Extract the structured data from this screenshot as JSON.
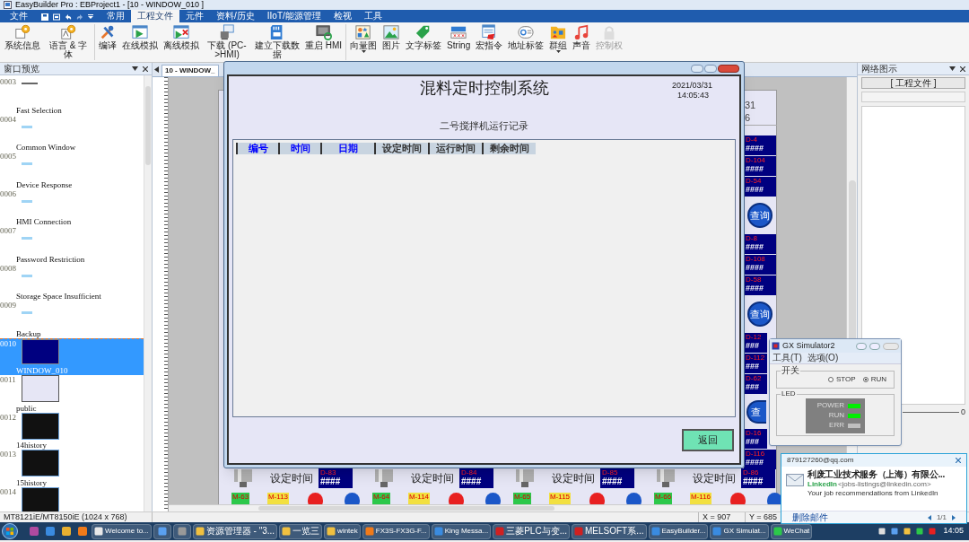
{
  "app_title": "EasyBuilder Pro : EBProject1 - [10 - WINDOW_010 ]",
  "menu_tabs": [
    {
      "label": "文件",
      "selected": false
    },
    {
      "label": "常用",
      "selected": false
    },
    {
      "label": "工程文件",
      "selected": true
    },
    {
      "label": "元件",
      "selected": false
    },
    {
      "label": "资料/历史",
      "selected": false
    },
    {
      "label": "IIoT/能源管理",
      "selected": false
    },
    {
      "label": "检视",
      "selected": false
    },
    {
      "label": "工具",
      "selected": false
    }
  ],
  "ribbon_groups": [
    [
      {
        "label": "系统信息",
        "dropdown": false,
        "disabled": false
      },
      {
        "label": "语言 & 字体",
        "dropdown": false,
        "disabled": false
      }
    ],
    [
      {
        "label": "编译",
        "dropdown": false,
        "disabled": false
      },
      {
        "label": "在线模拟",
        "dropdown": false,
        "disabled": false
      },
      {
        "label": "离线模拟",
        "dropdown": false,
        "disabled": false
      },
      {
        "label": "下载 (PC->HMI)",
        "dropdown": false,
        "disabled": false
      },
      {
        "label": "建立下载数据",
        "dropdown": false,
        "disabled": false
      },
      {
        "label": "重启 HMI",
        "dropdown": false,
        "disabled": false
      }
    ],
    [
      {
        "label": "向量图",
        "dropdown": true,
        "disabled": false
      },
      {
        "label": "图片",
        "dropdown": false,
        "disabled": false
      },
      {
        "label": "文字标签",
        "dropdown": false,
        "disabled": false
      },
      {
        "label": "String",
        "dropdown": false,
        "disabled": false
      },
      {
        "label": "宏指令",
        "dropdown": false,
        "disabled": false
      },
      {
        "label": "地址标签",
        "dropdown": false,
        "disabled": false
      },
      {
        "label": "群组",
        "dropdown": true,
        "disabled": false
      },
      {
        "label": "声音",
        "dropdown": false,
        "disabled": false
      },
      {
        "label": "控制权",
        "dropdown": false,
        "disabled": true
      }
    ]
  ],
  "window_preview": {
    "title": "窗口预览",
    "items": [
      {
        "number": "0003",
        "name": "Fast Selection",
        "selected": false
      },
      {
        "number": "0004",
        "name": "Common Window",
        "selected": false
      },
      {
        "number": "0005",
        "name": "Device Response",
        "selected": false
      },
      {
        "number": "0006",
        "name": "HMI Connection",
        "selected": false
      },
      {
        "number": "0007",
        "name": "Password Restriction",
        "selected": false
      },
      {
        "number": "0008",
        "name": "Storage Space Insufficient",
        "selected": false
      },
      {
        "number": "0009",
        "name": "Backup",
        "selected": false
      },
      {
        "number": "0010",
        "name": "WINDOW_010",
        "selected": true
      },
      {
        "number": "0011",
        "name": "public",
        "selected": false
      },
      {
        "number": "0012",
        "name": "14history",
        "selected": false
      },
      {
        "number": "0013",
        "name": "15history",
        "selected": false
      },
      {
        "number": "0014",
        "selected": false
      }
    ]
  },
  "editor_tab": "10 - WINDOW_",
  "hmi_right_strip": {
    "fragments": [
      "31",
      "6"
    ],
    "groups": [
      {
        "registers": [
          {
            "address": "D-4",
            "value": "####"
          },
          {
            "address": "D-104",
            "value": "####"
          },
          {
            "address": "D-54",
            "value": "####"
          }
        ],
        "button": "查询"
      },
      {
        "registers": [
          {
            "address": "D-8",
            "value": "####"
          },
          {
            "address": "D-108",
            "value": "####"
          },
          {
            "address": "D-58",
            "value": "####"
          }
        ],
        "button": "查询"
      },
      {
        "registers": [
          {
            "address": "D-12",
            "value": "###"
          },
          {
            "address": "D-112",
            "value": "###"
          },
          {
            "address": "D-62",
            "value": "###"
          }
        ],
        "button": "查"
      },
      {
        "registers": [
          {
            "address": "D-16",
            "value": "###"
          },
          {
            "address": "D-116",
            "value": "####"
          }
        ]
      }
    ]
  },
  "hmi_bottom_row": [
    {
      "label": "设定时间",
      "address": "D-83",
      "value": "####",
      "lamps": [
        "M-63",
        "M-113"
      ]
    },
    {
      "label": "设定时间",
      "address": "D-84",
      "value": "####",
      "lamps": [
        "M-64",
        "M-114"
      ]
    },
    {
      "label": "设定时间",
      "address": "D-85",
      "value": "####",
      "lamps": [
        "M-65",
        "M-115"
      ]
    },
    {
      "label": "设定时间",
      "address": "D-86",
      "value": "####",
      "lamps": [
        "M-66",
        "M-116"
      ]
    }
  ],
  "right_panel": {
    "title": "网络图示",
    "dropdown": "[ 工程文件 ]",
    "slider_reading": "0"
  },
  "dialog": {
    "title": "混料定时控制系统",
    "date": "2021/03/31",
    "time": "14:05:43",
    "subtitle": "二号搅拌机运行记录",
    "columns": [
      {
        "label": "编号",
        "color": "#0000ff"
      },
      {
        "label": "时间",
        "color": "#0000ff"
      },
      {
        "label": "日期",
        "color": "#0000ff"
      },
      {
        "label": "设定时间",
        "color": "#333333"
      },
      {
        "label": "运行时间",
        "color": "#333333"
      },
      {
        "label": "剩余时间",
        "color": "#333333"
      }
    ],
    "back_button": "返回"
  },
  "simulator": {
    "title": "GX Simulator2",
    "menu": [
      "工具(T)",
      "选项(O)"
    ],
    "switch_group": "开关",
    "modes": [
      {
        "label": "STOP",
        "selected": false
      },
      {
        "label": "RUN",
        "selected": true
      }
    ],
    "led_group": "LED",
    "leds": [
      {
        "label": "POWER",
        "on": true
      },
      {
        "label": "RUN",
        "on": true
      },
      {
        "label": "ERR",
        "on": false
      }
    ]
  },
  "status_bar": {
    "model": "MT8121iE/MT8150iE (1024 x 768)",
    "x": "X = 907",
    "y": "Y = 685"
  },
  "notification": {
    "account": "879127260@qq.com",
    "sender": "利废工业技术服务（上海）有限公...",
    "from_name": "LinkedIn",
    "from_address": "<jobs-listings@linkedin.com>",
    "subject": "Your job recommendations from LinkedIn",
    "delete": "删除邮件",
    "pager": "1/1"
  },
  "taskbar": {
    "items": [
      {
        "kind": "labeled",
        "label": "Welcome to..."
      },
      {
        "kind": "icon"
      },
      {
        "kind": "icon"
      },
      {
        "kind": "labeled",
        "label": "资源管理器 - \"3..."
      },
      {
        "kind": "labeled",
        "label": "一览三"
      },
      {
        "kind": "labeled",
        "label": "wintek"
      },
      {
        "kind": "labeled",
        "label": "FX3S-FX3G-F..."
      },
      {
        "kind": "labeled",
        "label": "King Messa..."
      },
      {
        "kind": "labeled",
        "label": "三菱PLC与变..."
      },
      {
        "kind": "labeled",
        "label": "MELSOFT系..."
      },
      {
        "kind": "labeled",
        "label": "EasyBuilder..."
      },
      {
        "kind": "labeled",
        "label": "GX Simulat..."
      },
      {
        "kind": "labeled",
        "label": "WeChat"
      }
    ],
    "clock": "14:05"
  }
}
